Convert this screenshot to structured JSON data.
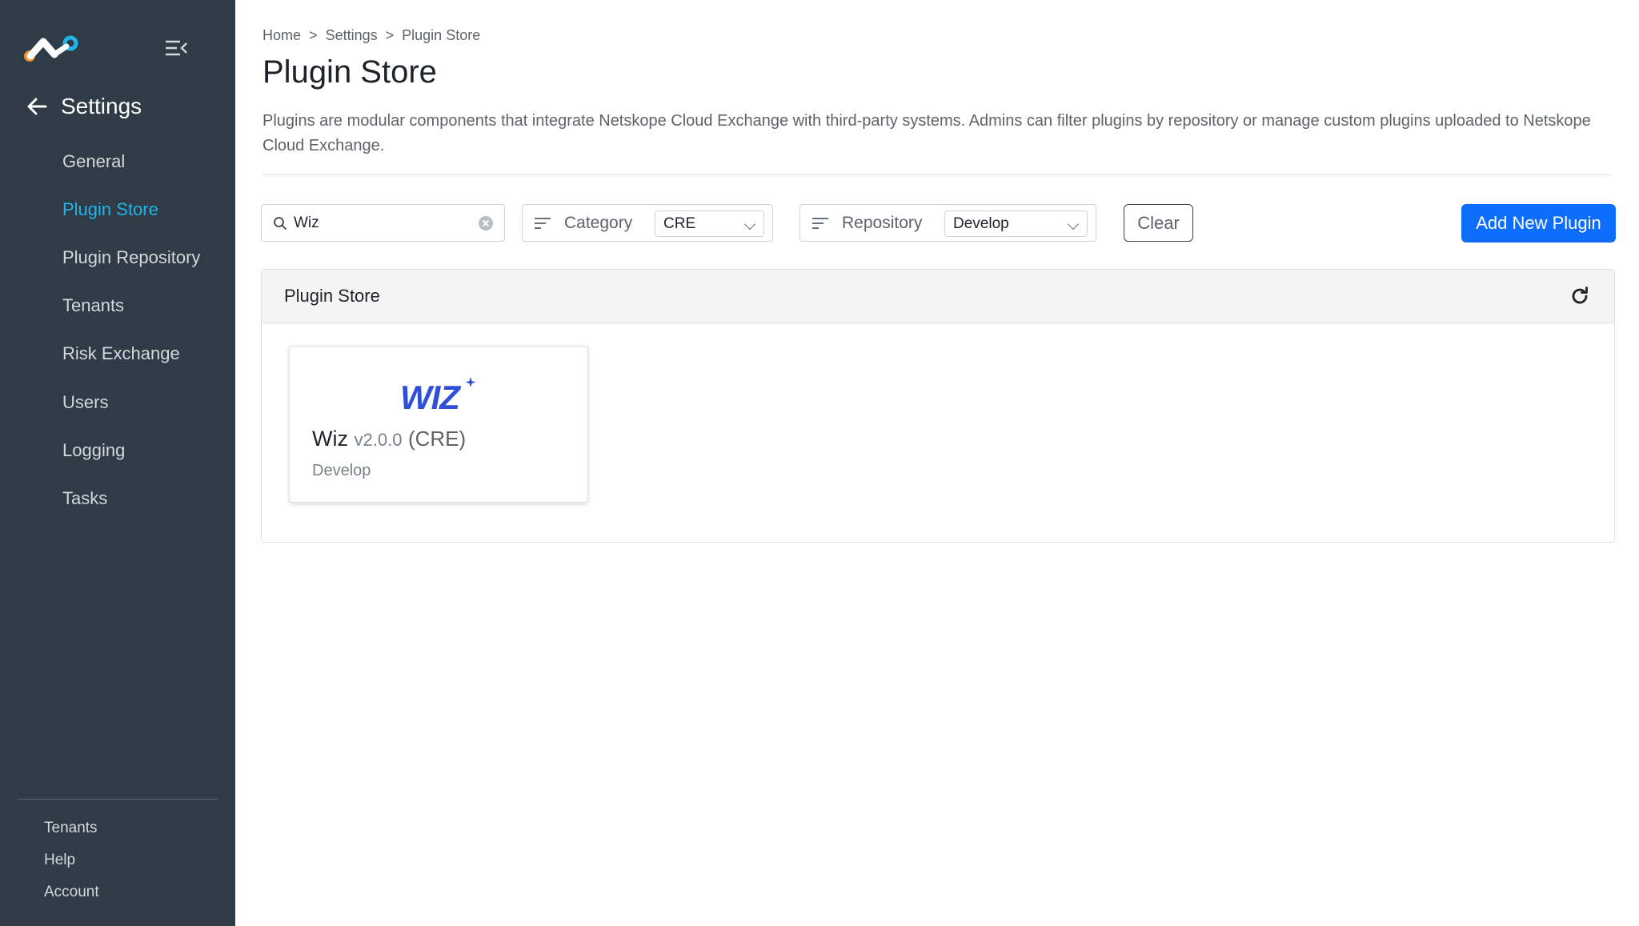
{
  "sidebar": {
    "section_title": "Settings",
    "nav_items": [
      {
        "label": "General",
        "active": false
      },
      {
        "label": "Plugin Store",
        "active": true
      },
      {
        "label": "Plugin Repository",
        "active": false
      },
      {
        "label": "Tenants",
        "active": false
      },
      {
        "label": "Risk Exchange",
        "active": false
      },
      {
        "label": "Users",
        "active": false
      },
      {
        "label": "Logging",
        "active": false
      },
      {
        "label": "Tasks",
        "active": false
      }
    ],
    "footer_items": [
      "Tenants",
      "Help",
      "Account"
    ]
  },
  "breadcrumb": {
    "items": [
      "Home",
      "Settings",
      "Plugin Store"
    ],
    "separator": ">"
  },
  "page": {
    "title": "Plugin Store",
    "description": "Plugins are modular components that integrate Netskope Cloud Exchange with third-party systems. Admins can filter plugins by repository or manage custom plugins uploaded to Netskope Cloud Exchange."
  },
  "filters": {
    "search_value": "Wiz",
    "category_label": "Category",
    "category_value": "CRE",
    "repository_label": "Repository",
    "repository_value": "Develop",
    "clear_label": "Clear",
    "add_label": "Add New Plugin"
  },
  "panel": {
    "title": "Plugin Store",
    "plugins": [
      {
        "name": "Wiz",
        "version": "v2.0.0",
        "category": "(CRE)",
        "repository": "Develop",
        "logo_text": "WIZ"
      }
    ]
  },
  "colors": {
    "sidebar_bg": "#2f3b46",
    "accent": "#20b4e8",
    "primary_button": "#0d6efd",
    "wiz_logo": "#2f4fd9"
  }
}
